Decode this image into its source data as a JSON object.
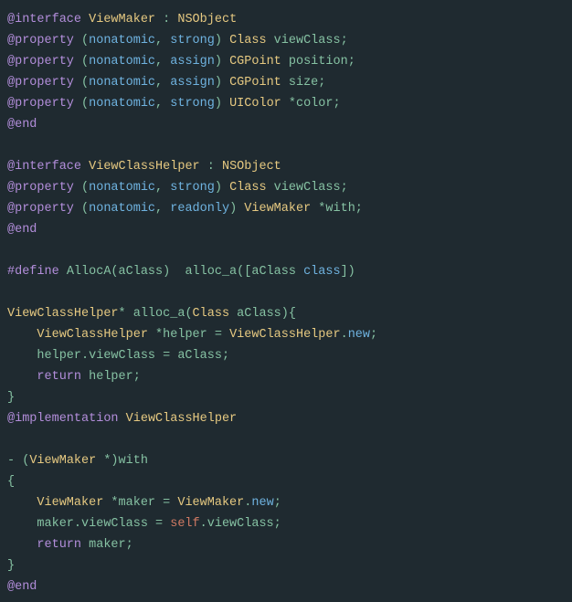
{
  "code": {
    "lines": [
      [
        {
          "cls": "kw",
          "t": "@interface"
        },
        {
          "cls": "ident",
          "t": " "
        },
        {
          "cls": "type",
          "t": "ViewMaker"
        },
        {
          "cls": "ident",
          "t": " : "
        },
        {
          "cls": "type",
          "t": "NSObject"
        }
      ],
      [
        {
          "cls": "kw",
          "t": "@property"
        },
        {
          "cls": "ident",
          "t": " ("
        },
        {
          "cls": "attr",
          "t": "nonatomic"
        },
        {
          "cls": "ident",
          "t": ", "
        },
        {
          "cls": "attr",
          "t": "strong"
        },
        {
          "cls": "ident",
          "t": ") "
        },
        {
          "cls": "type",
          "t": "Class"
        },
        {
          "cls": "ident",
          "t": " viewClass;"
        }
      ],
      [
        {
          "cls": "kw",
          "t": "@property"
        },
        {
          "cls": "ident",
          "t": " ("
        },
        {
          "cls": "attr",
          "t": "nonatomic"
        },
        {
          "cls": "ident",
          "t": ", "
        },
        {
          "cls": "attr",
          "t": "assign"
        },
        {
          "cls": "ident",
          "t": ") "
        },
        {
          "cls": "type",
          "t": "CGPoint"
        },
        {
          "cls": "ident",
          "t": " position;"
        }
      ],
      [
        {
          "cls": "kw",
          "t": "@property"
        },
        {
          "cls": "ident",
          "t": " ("
        },
        {
          "cls": "attr",
          "t": "nonatomic"
        },
        {
          "cls": "ident",
          "t": ", "
        },
        {
          "cls": "attr",
          "t": "assign"
        },
        {
          "cls": "ident",
          "t": ") "
        },
        {
          "cls": "type",
          "t": "CGPoint"
        },
        {
          "cls": "ident",
          "t": " size;"
        }
      ],
      [
        {
          "cls": "kw",
          "t": "@property"
        },
        {
          "cls": "ident",
          "t": " ("
        },
        {
          "cls": "attr",
          "t": "nonatomic"
        },
        {
          "cls": "ident",
          "t": ", "
        },
        {
          "cls": "attr",
          "t": "strong"
        },
        {
          "cls": "ident",
          "t": ") "
        },
        {
          "cls": "type",
          "t": "UIColor"
        },
        {
          "cls": "ident",
          "t": " *color;"
        }
      ],
      [
        {
          "cls": "kw",
          "t": "@end"
        }
      ],
      [
        {
          "cls": "ident",
          "t": ""
        }
      ],
      [
        {
          "cls": "kw",
          "t": "@interface"
        },
        {
          "cls": "ident",
          "t": " "
        },
        {
          "cls": "type",
          "t": "ViewClassHelper"
        },
        {
          "cls": "ident",
          "t": " : "
        },
        {
          "cls": "type",
          "t": "NSObject"
        }
      ],
      [
        {
          "cls": "kw",
          "t": "@property"
        },
        {
          "cls": "ident",
          "t": " ("
        },
        {
          "cls": "attr",
          "t": "nonatomic"
        },
        {
          "cls": "ident",
          "t": ", "
        },
        {
          "cls": "attr",
          "t": "strong"
        },
        {
          "cls": "ident",
          "t": ") "
        },
        {
          "cls": "type",
          "t": "Class"
        },
        {
          "cls": "ident",
          "t": " viewClass;"
        }
      ],
      [
        {
          "cls": "kw",
          "t": "@property"
        },
        {
          "cls": "ident",
          "t": " ("
        },
        {
          "cls": "attr",
          "t": "nonatomic"
        },
        {
          "cls": "ident",
          "t": ", "
        },
        {
          "cls": "attr",
          "t": "readonly"
        },
        {
          "cls": "ident",
          "t": ") "
        },
        {
          "cls": "type",
          "t": "ViewMaker"
        },
        {
          "cls": "ident",
          "t": " *with;"
        }
      ],
      [
        {
          "cls": "kw",
          "t": "@end"
        }
      ],
      [
        {
          "cls": "ident",
          "t": ""
        }
      ],
      [
        {
          "cls": "kw",
          "t": "#define"
        },
        {
          "cls": "ident",
          "t": " AllocA(aClass)  alloc_a([aClass "
        },
        {
          "cls": "attr",
          "t": "class"
        },
        {
          "cls": "ident",
          "t": "])"
        }
      ],
      [
        {
          "cls": "ident",
          "t": ""
        }
      ],
      [
        {
          "cls": "type",
          "t": "ViewClassHelper"
        },
        {
          "cls": "ident",
          "t": "* alloc_a("
        },
        {
          "cls": "type",
          "t": "Class"
        },
        {
          "cls": "ident",
          "t": " aClass){"
        }
      ],
      [
        {
          "cls": "ident",
          "t": "    "
        },
        {
          "cls": "type",
          "t": "ViewClassHelper"
        },
        {
          "cls": "ident",
          "t": " *helper = "
        },
        {
          "cls": "type",
          "t": "ViewClassHelper"
        },
        {
          "cls": "ident",
          "t": "."
        },
        {
          "cls": "attr",
          "t": "new"
        },
        {
          "cls": "ident",
          "t": ";"
        }
      ],
      [
        {
          "cls": "ident",
          "t": "    helper.viewClass = aClass;"
        }
      ],
      [
        {
          "cls": "ident",
          "t": "    "
        },
        {
          "cls": "kw",
          "t": "return"
        },
        {
          "cls": "ident",
          "t": " helper;"
        }
      ],
      [
        {
          "cls": "ident",
          "t": "}"
        }
      ],
      [
        {
          "cls": "kw",
          "t": "@implementation"
        },
        {
          "cls": "ident",
          "t": " "
        },
        {
          "cls": "type",
          "t": "ViewClassHelper"
        }
      ],
      [
        {
          "cls": "ident",
          "t": ""
        }
      ],
      [
        {
          "cls": "ident",
          "t": "- ("
        },
        {
          "cls": "type",
          "t": "ViewMaker"
        },
        {
          "cls": "ident",
          "t": " *)with"
        }
      ],
      [
        {
          "cls": "ident",
          "t": "{"
        }
      ],
      [
        {
          "cls": "ident",
          "t": "    "
        },
        {
          "cls": "type",
          "t": "ViewMaker"
        },
        {
          "cls": "ident",
          "t": " *maker = "
        },
        {
          "cls": "type",
          "t": "ViewMaker"
        },
        {
          "cls": "ident",
          "t": "."
        },
        {
          "cls": "attr",
          "t": "new"
        },
        {
          "cls": "ident",
          "t": ";"
        }
      ],
      [
        {
          "cls": "ident",
          "t": "    maker.viewClass = "
        },
        {
          "cls": "self",
          "t": "self"
        },
        {
          "cls": "ident",
          "t": ".viewClass;"
        }
      ],
      [
        {
          "cls": "ident",
          "t": "    "
        },
        {
          "cls": "kw",
          "t": "return"
        },
        {
          "cls": "ident",
          "t": " maker;"
        }
      ],
      [
        {
          "cls": "ident",
          "t": "}"
        }
      ],
      [
        {
          "cls": "kw",
          "t": "@end"
        }
      ]
    ]
  }
}
